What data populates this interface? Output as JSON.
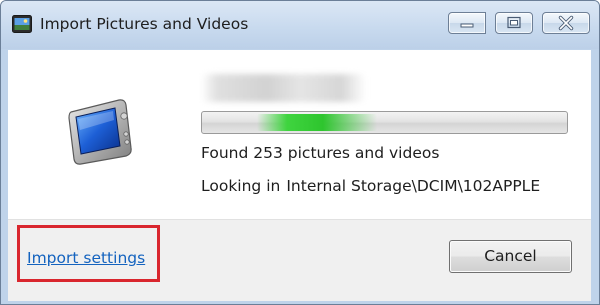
{
  "window": {
    "title": "Import Pictures and Videos",
    "controls": {
      "minimize": "minimize-icon",
      "maximize": "maximize-icon",
      "close": "close-icon"
    }
  },
  "device": {
    "icon": "portable-device-icon",
    "name_blurred": true
  },
  "progress": {
    "mode": "indeterminate",
    "color": "#3fd43f"
  },
  "status": {
    "found_text": "Found 253 pictures and videos",
    "looking_prefix": "Looking in",
    "looking_path": "Internal Storage\\DCIM\\102APPLE"
  },
  "footer": {
    "settings_link": "Import settings",
    "cancel_label": "Cancel"
  },
  "colors": {
    "highlight_border": "#d9262e",
    "link": "#1463bf",
    "frame": "#bfd3ea"
  }
}
